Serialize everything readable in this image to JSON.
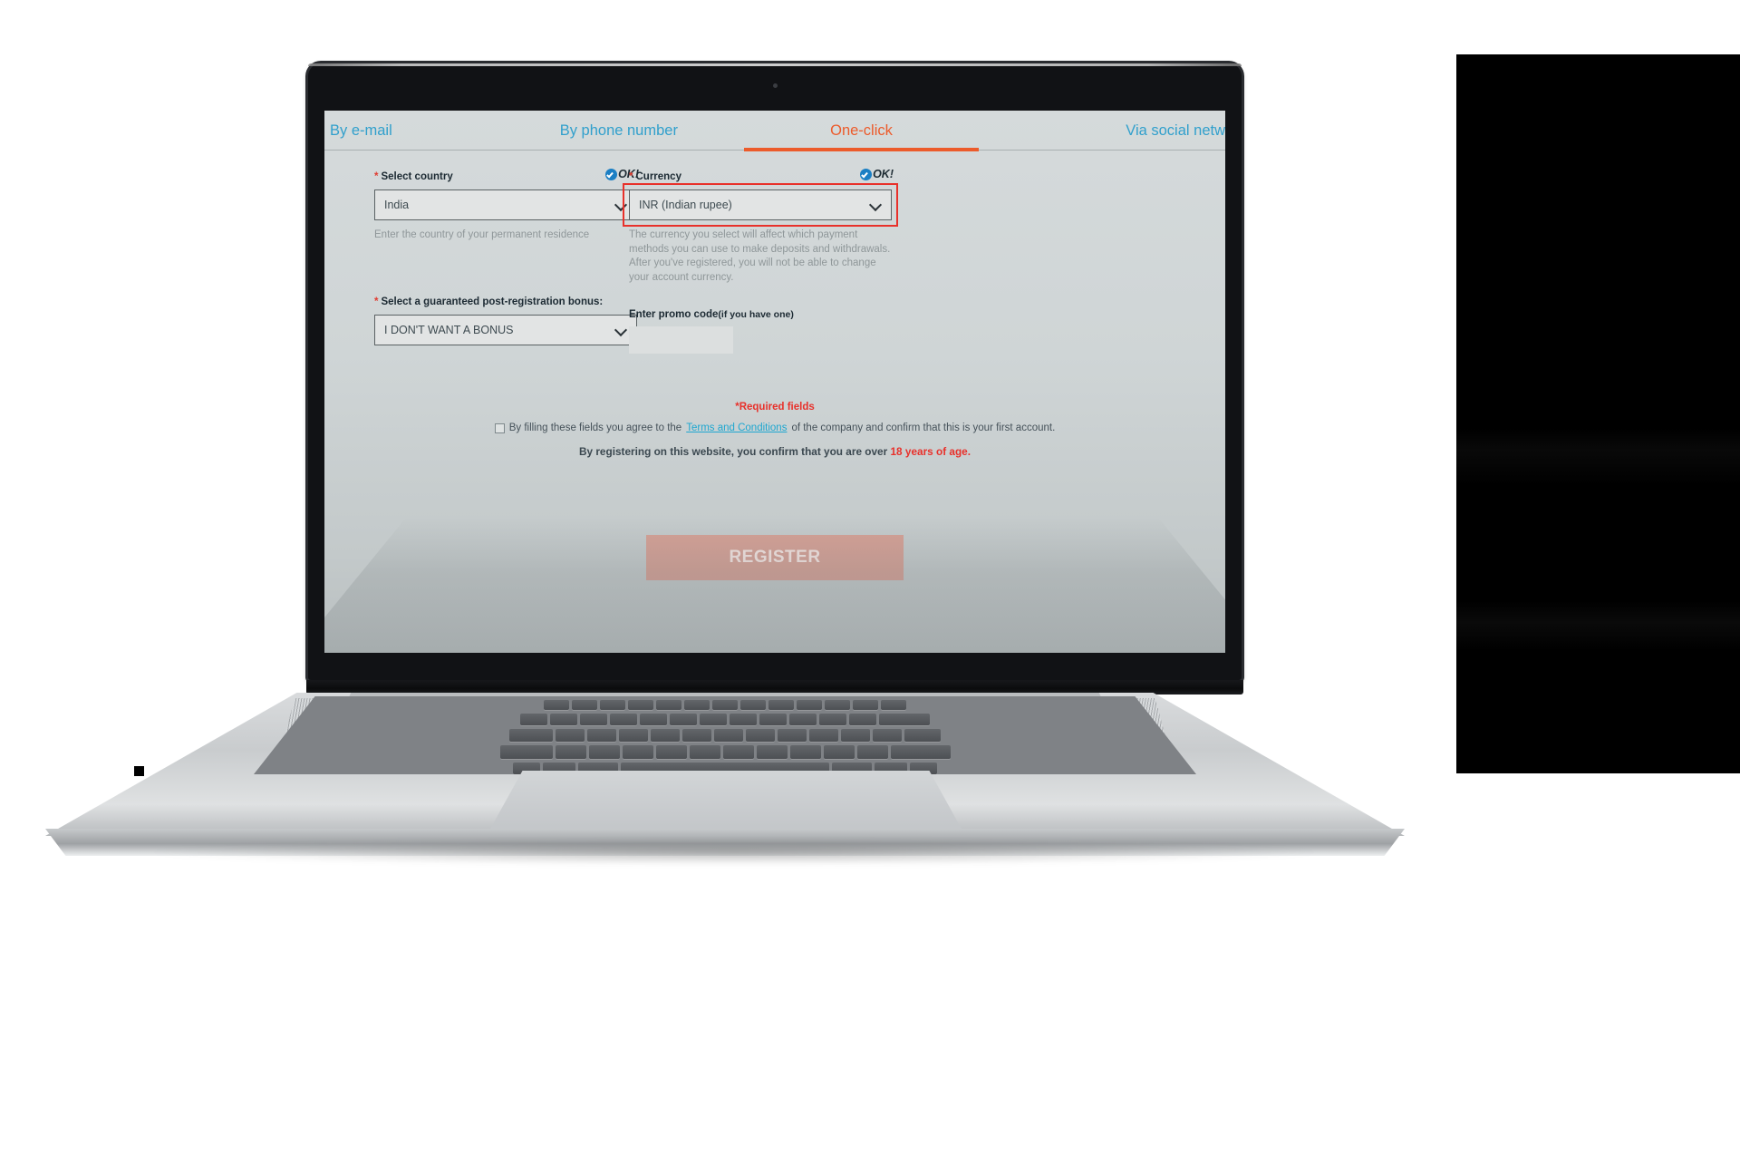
{
  "tabs": [
    {
      "label": "By e-mail",
      "active": false
    },
    {
      "label": "By phone number",
      "active": false
    },
    {
      "label": "One-click",
      "active": true
    },
    {
      "label": "Via social netw",
      "active": false
    }
  ],
  "country_field": {
    "required_star": "*",
    "label": "Select country",
    "ok_text": "OK!",
    "value": "India",
    "hint": "Enter the country of your permanent residence"
  },
  "currency_field": {
    "required_star": "*",
    "label": "Currency",
    "ok_text": "OK!",
    "value": "INR (Indian rupee)",
    "hint": "The currency you select will affect which payment methods you can use to make deposits and withdrawals. After you've registered, you will not be able to change your account currency."
  },
  "bonus_field": {
    "required_star": "*",
    "label": "Select a guaranteed post-registration bonus:",
    "value": "I DON'T WANT A BONUS"
  },
  "promo_field": {
    "label_main": "Enter promo code",
    "label_sub": "(if you have one)",
    "value": "",
    "placeholder": ""
  },
  "footer": {
    "required_note": "*Required fields",
    "agree_pre": "By filling these fields you agree to the",
    "terms_link": "Terms and Conditions",
    "agree_post": "of the company and confirm that this is your first account.",
    "age_pre": "By registering on this website, you confirm that you are over",
    "age_red": "18 years of age.",
    "register_label": "REGISTER"
  },
  "colors": {
    "accent_orange": "#ec5b2b",
    "tab_blue": "#31a0cc",
    "required_red": "#e8312b",
    "highlight_red": "#e8312b",
    "ok_blue": "#1b7fc4",
    "link_blue": "#1fa7d0"
  }
}
